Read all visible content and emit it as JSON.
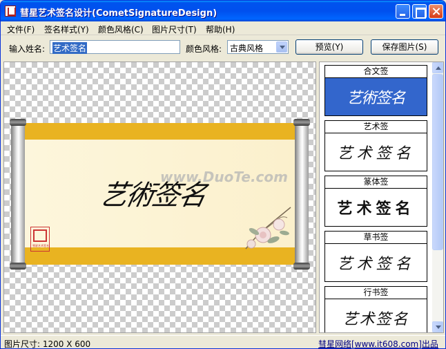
{
  "window": {
    "title": "彗星艺术签名设计(CometSignatureDesign)"
  },
  "menu": {
    "items": [
      {
        "label": "文件(F)"
      },
      {
        "label": "签名样式(Y)"
      },
      {
        "label": "颜色风格(C)"
      },
      {
        "label": "图片尺寸(T)"
      },
      {
        "label": "帮助(H)"
      }
    ]
  },
  "toolbar": {
    "name_label": "输入姓名:",
    "name_value": "艺术签名",
    "color_label": "颜色风格:",
    "color_value": "古典风格",
    "preview_label": "预览(Y)",
    "save_label": "保存图片(S)"
  },
  "canvas": {
    "signature_text": "艺術签名",
    "seal_text": "彗星艺术签名",
    "watermark": "www.DuoTe.com"
  },
  "styles": {
    "items": [
      {
        "label": "合文签",
        "preview": "艺術签名",
        "selected": true
      },
      {
        "label": "艺术签",
        "preview": "艺术签名",
        "selected": false
      },
      {
        "label": "篆体签",
        "preview": "艺术签名",
        "selected": false
      },
      {
        "label": "草书签",
        "preview": "艺术签名",
        "selected": false
      },
      {
        "label": "行书签",
        "preview": "艺术签名",
        "selected": false
      }
    ]
  },
  "status": {
    "size_text": "图片尺寸: 1200 X 600",
    "link_text": "彗星网络[www.it608.com]出品"
  },
  "colors": {
    "title_bar": "#0054e3",
    "selected_card": "#3366cc",
    "scroll_gold": "#e9b321"
  }
}
